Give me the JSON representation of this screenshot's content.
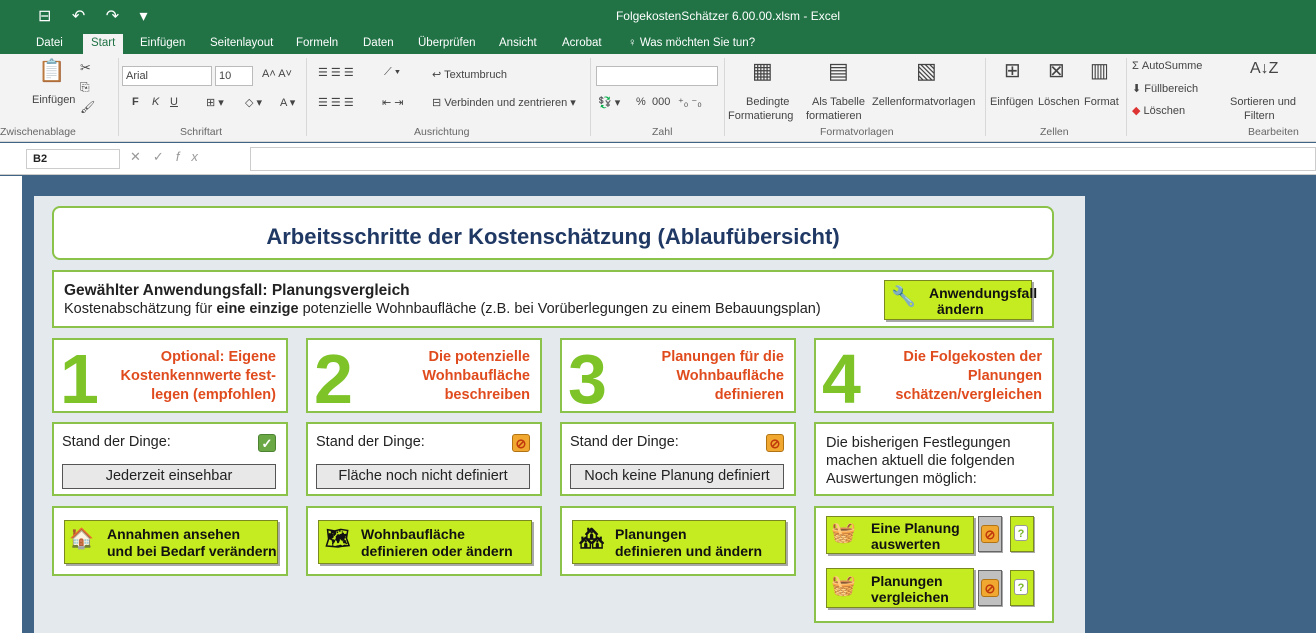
{
  "window": {
    "title": "FolgekostenSchätzer 6.00.00.xlsm - Excel",
    "quick_access": "⊟ ↶ ↷ ▾"
  },
  "tabs": [
    "Datei",
    "Start",
    "Einfügen",
    "Seitenlayout",
    "Formeln",
    "Daten",
    "Überprüfen",
    "Ansicht",
    "Acrobat",
    "Was möchten Sie tun?"
  ],
  "ribbon": {
    "paste": "Einfügen",
    "clipboard_group": "Zwischenablage",
    "font_name": "Arial",
    "font_size": "10",
    "font_group": "Schriftart",
    "bold": "F",
    "italic": "K",
    "underline": "U",
    "wrap": "Textumbruch",
    "merge": "Verbinden und zentrieren",
    "align_group": "Ausrichtung",
    "number_group": "Zahl",
    "percent": "%",
    "thousands": "000",
    "cond_format": "Bedingte",
    "cond_format2": "Formatierung",
    "as_table": "Als Tabelle",
    "as_table2": "formatieren",
    "cell_styles": "Zellenformatvorlagen",
    "styles_group": "Formatvorlagen",
    "insert": "Einfügen",
    "delete": "Löschen",
    "format": "Format",
    "cells_group": "Zellen",
    "autosum": "AutoSumme",
    "fill": "Füllbereich",
    "clear": "Löschen",
    "sort": "Sortieren und",
    "filter": "Filtern",
    "edit_group": "Bearbeiten"
  },
  "formula_bar": {
    "namebox": "B2",
    "fx": "fx",
    "value": ""
  },
  "sheet": {
    "title": "Arbeitsschritte der Kostenschätzung (Ablaufübersicht)",
    "case_heading": "Gewählter Anwendungsfall: Planungsvergleich",
    "case_desc_pre": "Kostenabschätzung für ",
    "case_desc_bold": "eine einzige",
    "case_desc_post": " potenzielle Wohnbaufläche (z.B. bei Vorüberlegungen zu einem Bebauungsplan)",
    "change_btn_1": "Anwendungsfall",
    "change_btn_2": "ändern",
    "steps": [
      {
        "num": "1",
        "l1": "Optional: Eigene",
        "l2": "Kostenkennwerte fest-",
        "l3": "legen (empfohlen)"
      },
      {
        "num": "2",
        "l1": "Die potenzielle",
        "l2": "Wohnbaufläche",
        "l3": "beschreiben"
      },
      {
        "num": "3",
        "l1": "Planungen für die",
        "l2": "Wohnbaufläche",
        "l3": "definieren"
      },
      {
        "num": "4",
        "l1": "Die Folgekosten der",
        "l2": "Planungen",
        "l3": "schätzen/vergleichen"
      }
    ],
    "stand_label": "Stand der Dinge:",
    "status": [
      "Jederzeit einsehbar",
      "Fläche noch nicht definiert",
      "Noch keine Planung definiert"
    ],
    "status4": [
      "Die bisherigen Festlegungen",
      "machen aktuell die folgenden",
      "Auswertungen möglich:"
    ],
    "actions": [
      {
        "l1": "Annahmen ansehen",
        "l2": "und bei Bedarf verändern"
      },
      {
        "l1": "Wohnbaufläche",
        "l2": "definieren oder ändern"
      },
      {
        "l1": "Planungen",
        "l2": "definieren und ändern"
      }
    ],
    "eval": [
      {
        "l1": "Eine Planung",
        "l2": "auswerten"
      },
      {
        "l1": "Planungen",
        "l2": "vergleichen"
      }
    ],
    "help": "?",
    "ok_icon": "✓",
    "no_icon": "⊘"
  },
  "colors": {
    "excel_green": "#217346",
    "accent_green": "#c5ec20",
    "step_orange": "#e04b1e",
    "title_blue": "#1f3864"
  }
}
